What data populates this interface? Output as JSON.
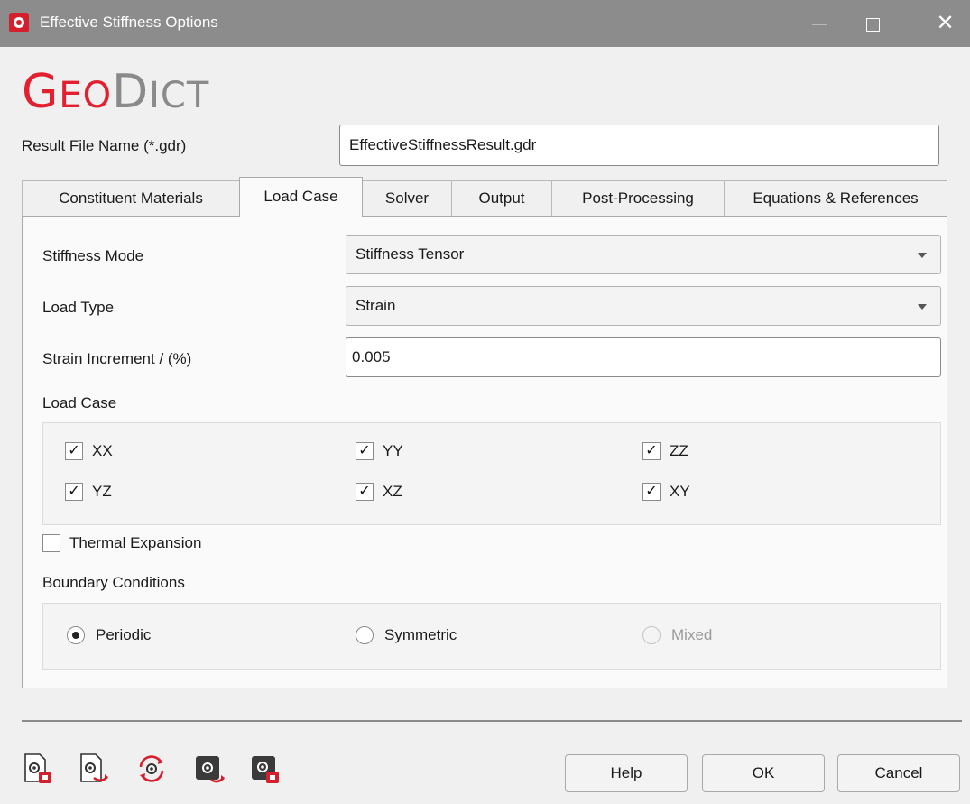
{
  "window": {
    "title": "Effective Stiffness Options",
    "logo_big_g": "G",
    "logo_eo": "EO",
    "logo_big_d": "D",
    "logo_ict": "ICT"
  },
  "result_file": {
    "label": "Result File Name (*.gdr)",
    "value": "EffectiveStiffnessResult.gdr"
  },
  "tabs": [
    {
      "label": "Constituent Materials"
    },
    {
      "label": "Load Case"
    },
    {
      "label": "Solver"
    },
    {
      "label": "Output"
    },
    {
      "label": "Post-Processing"
    },
    {
      "label": "Equations & References"
    }
  ],
  "active_tab": "Load Case",
  "load_case_tab": {
    "stiffness_mode": {
      "label": "Stiffness Mode",
      "value": "Stiffness Tensor"
    },
    "load_type": {
      "label": "Load Type",
      "value": "Strain"
    },
    "strain_increment": {
      "label": "Strain Increment / (%)",
      "value": "0.005"
    },
    "load_case": {
      "label": "Load Case",
      "items": [
        {
          "label": "XX",
          "checked": true
        },
        {
          "label": "YY",
          "checked": true
        },
        {
          "label": "ZZ",
          "checked": true
        },
        {
          "label": "YZ",
          "checked": true
        },
        {
          "label": "XZ",
          "checked": true
        },
        {
          "label": "XY",
          "checked": true
        }
      ]
    },
    "thermal_expansion": {
      "label": "Thermal Expansion",
      "checked": false
    },
    "boundary_conditions": {
      "label": "Boundary Conditions",
      "options": [
        {
          "label": "Periodic",
          "selected": true,
          "enabled": true
        },
        {
          "label": "Symmetric",
          "selected": false,
          "enabled": true
        },
        {
          "label": "Mixed",
          "selected": false,
          "enabled": false
        }
      ]
    }
  },
  "footer": {
    "help_label": "Help",
    "ok_label": "OK",
    "cancel_label": "Cancel"
  },
  "colors": {
    "accent_red": "#d51f2c",
    "logo_gray": "#8a8a8a",
    "titlebar": "#8c8c8c"
  }
}
